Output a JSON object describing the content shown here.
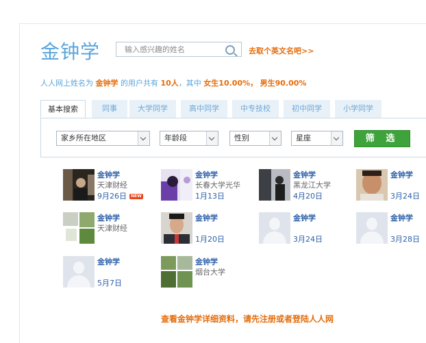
{
  "header": {
    "title": "金钟学",
    "search_placeholder": "输入感兴趣的姓名",
    "english_name_link": "去取个英文名吧>>"
  },
  "stats": {
    "prefix": "人人网上姓名为",
    "name": "金钟学",
    "mid": "的用户共有",
    "count": "10人",
    "sep": "，其中",
    "female": "女生10.00%",
    "sep2": "，",
    "male": "男生90.00%"
  },
  "tabs": [
    {
      "label": "基本搜索",
      "active": true
    },
    {
      "label": "同事"
    },
    {
      "label": "大学同学"
    },
    {
      "label": "高中同学"
    },
    {
      "label": "中专技校"
    },
    {
      "label": "初中同学"
    },
    {
      "label": "小学同学"
    }
  ],
  "filters": {
    "hometown": "家乡所在地区",
    "age": "年龄段",
    "gender": "性别",
    "zodiac": "星座",
    "submit": "筛 选"
  },
  "users": [
    {
      "name": "金钟学",
      "school": "天津财经",
      "date": "9月26日",
      "badge": "NEW",
      "avatar": "photo-dark"
    },
    {
      "name": "金钟学",
      "school": "长春大学光华",
      "date": "1月13日",
      "avatar": "photo-purple"
    },
    {
      "name": "金钟学",
      "school": "黑龙江大学",
      "date": "4月20日",
      "avatar": "photo-mirror"
    },
    {
      "name": "金钟学",
      "school": "",
      "date": "3月24日",
      "avatar": "photo-face"
    },
    {
      "name": "金钟学",
      "school": "天津财经",
      "date": "",
      "avatar": "photo-plants"
    },
    {
      "name": "金钟学",
      "school": "",
      "date": "1月20日",
      "avatar": "photo-suit"
    },
    {
      "name": "金钟学",
      "school": "",
      "date": "3月24日",
      "avatar": "placeholder"
    },
    {
      "name": "金钟学",
      "school": "",
      "date": "3月28日",
      "avatar": "placeholder"
    },
    {
      "name": "金钟学",
      "school": "",
      "date": "5月7日",
      "avatar": "placeholder"
    },
    {
      "name": "金钟学",
      "school": "烟台大学",
      "date": "",
      "avatar": "photo-garden"
    }
  ],
  "footer": {
    "text": "查看金钟学详细资料，请先注册或者登陆人人网"
  }
}
